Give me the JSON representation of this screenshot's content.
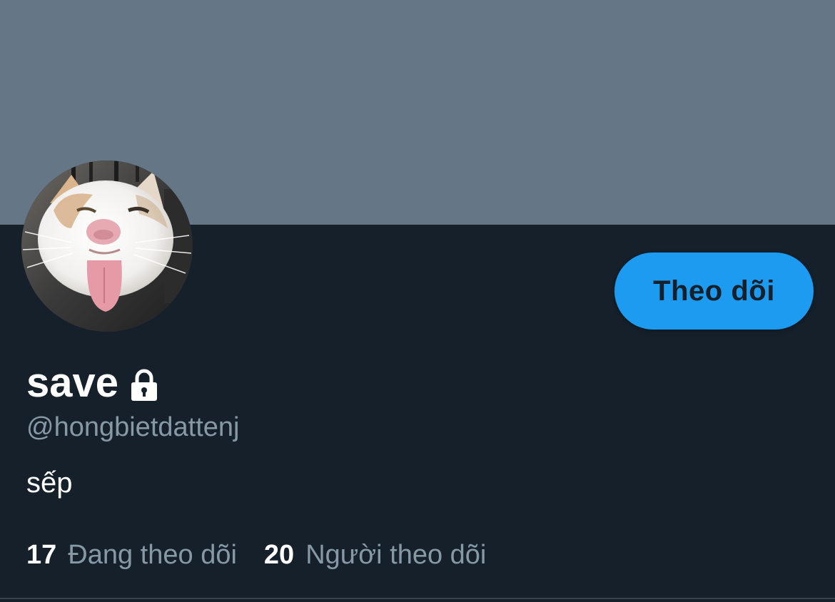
{
  "colors": {
    "banner": "#657786",
    "background": "#15202b",
    "accent": "#1d9bf0",
    "secondary_text": "#8899a6",
    "primary_text": "#ffffff"
  },
  "profile": {
    "avatar_icon": "cat-avatar-photo",
    "display_name": "save",
    "protected_icon": "lock-icon",
    "handle": "@hongbietdattenj",
    "bio": "sếp"
  },
  "actions": {
    "follow_label": "Theo dõi"
  },
  "stats": {
    "following_count": "17",
    "following_label": "Đang theo dõi",
    "followers_count": "20",
    "followers_label": "Người theo dõi"
  }
}
